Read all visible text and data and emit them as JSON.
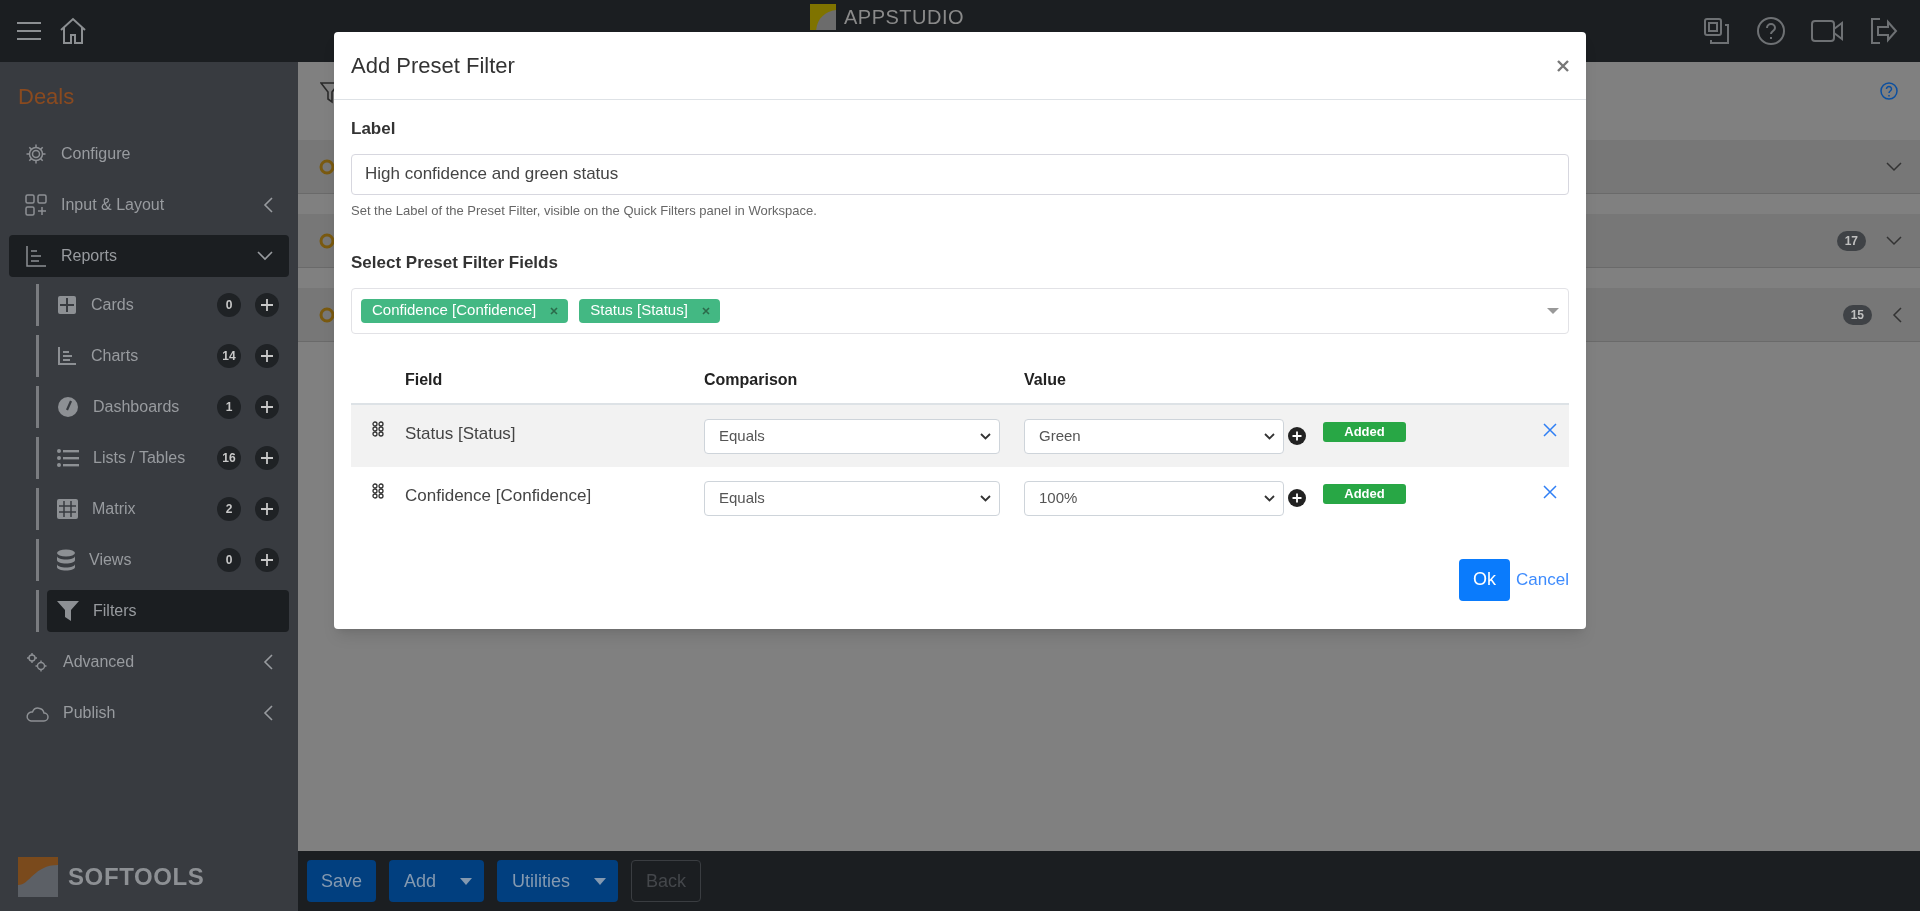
{
  "top_bar": {
    "logo_text": "APPSTUDIO"
  },
  "sidebar": {
    "app_title": "Deals",
    "items": [
      {
        "label": "Configure",
        "selected": false
      },
      {
        "label": "Input & Layout",
        "expanded": false,
        "selected": false
      },
      {
        "label": "Reports",
        "expanded": true,
        "selected": true,
        "children": [
          {
            "label": "Cards",
            "count": "0",
            "selected": false
          },
          {
            "label": "Charts",
            "count": "14",
            "selected": false
          },
          {
            "label": "Dashboards",
            "count": "1",
            "selected": false
          },
          {
            "label": "Lists / Tables",
            "count": "16",
            "selected": false
          },
          {
            "label": "Matrix",
            "count": "2",
            "selected": false
          },
          {
            "label": "Views",
            "count": "0",
            "selected": false
          },
          {
            "label": "Filters",
            "selected": true
          }
        ]
      },
      {
        "label": "Advanced",
        "expanded": false,
        "selected": false
      },
      {
        "label": "Publish",
        "expanded": false,
        "selected": false
      }
    ],
    "brand": "SOFTOOLS"
  },
  "background_rows": [
    {
      "expanded": true
    },
    {
      "badge": "17",
      "expanded": true
    },
    {
      "badge": "15",
      "expanded": false
    }
  ],
  "modal": {
    "title": "Add Preset Filter",
    "label_heading": "Label",
    "label_value": "High confidence and green status",
    "label_hint": "Set the Label of the Preset Filter, visible on the Quick Filters panel in Workspace.",
    "fields_heading": "Select Preset Filter Fields",
    "chips": [
      "Confidence [Confidence]",
      "Status [Status]"
    ],
    "columns": [
      "Field",
      "Comparison",
      "Value"
    ],
    "rows": [
      {
        "field": "Status [Status]",
        "comparison": "Equals",
        "value": "Green",
        "status": "Added",
        "highlighted": true
      },
      {
        "field": "Confidence [Confidence]",
        "comparison": "Equals",
        "value": "100%",
        "status": "Added",
        "highlighted": false
      }
    ],
    "ok": "Ok",
    "cancel": "Cancel"
  },
  "bottom_bar": {
    "buttons": [
      {
        "label": "Save",
        "dropdown": false,
        "disabled": false
      },
      {
        "label": "Add",
        "dropdown": true,
        "disabled": false
      },
      {
        "label": "Utilities",
        "dropdown": true,
        "disabled": false
      },
      {
        "label": "Back",
        "dropdown": false,
        "disabled": true
      }
    ]
  }
}
